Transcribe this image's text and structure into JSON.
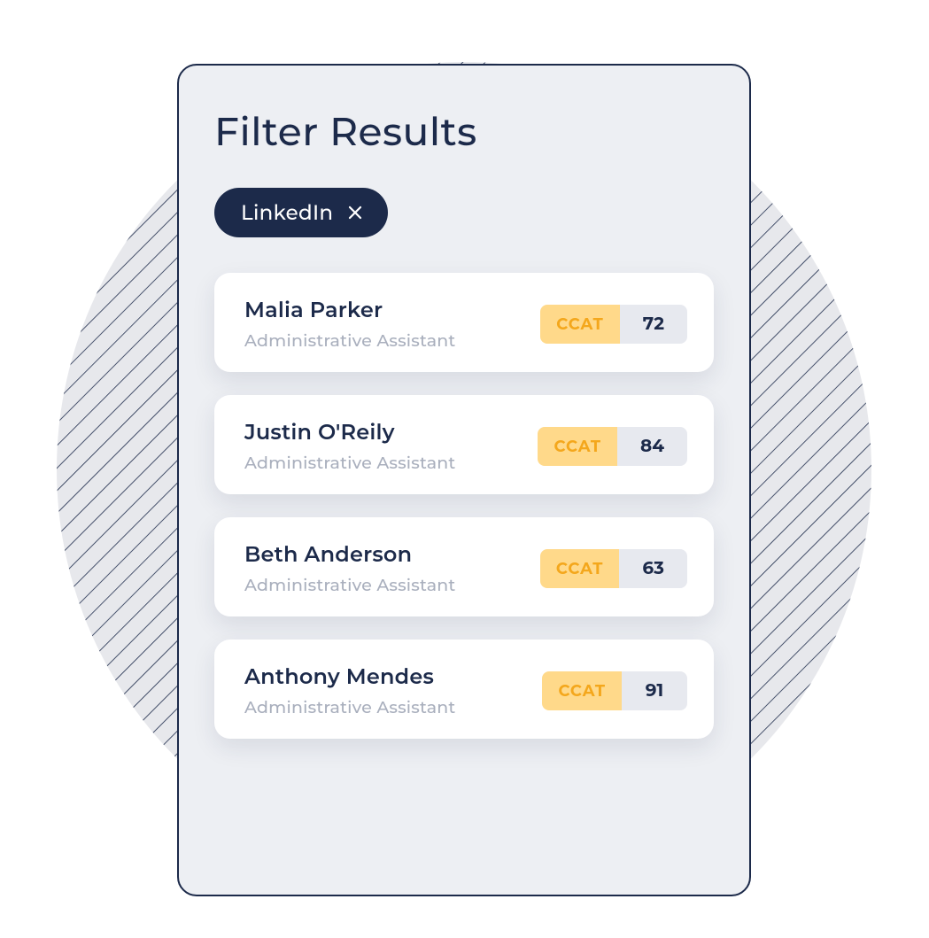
{
  "title": "Filter Results",
  "filter_chip": {
    "label": "LinkedIn"
  },
  "score_label": "CCAT",
  "results": [
    {
      "name": "Malia Parker",
      "role": "Administrative Assistant",
      "score": "72"
    },
    {
      "name": "Justin O'Reily",
      "role": "Administrative Assistant",
      "score": "84"
    },
    {
      "name": "Beth Anderson",
      "role": "Administrative Assistant",
      "score": "63"
    },
    {
      "name": "Anthony Mendes",
      "role": "Administrative Assistant",
      "score": "91"
    }
  ]
}
